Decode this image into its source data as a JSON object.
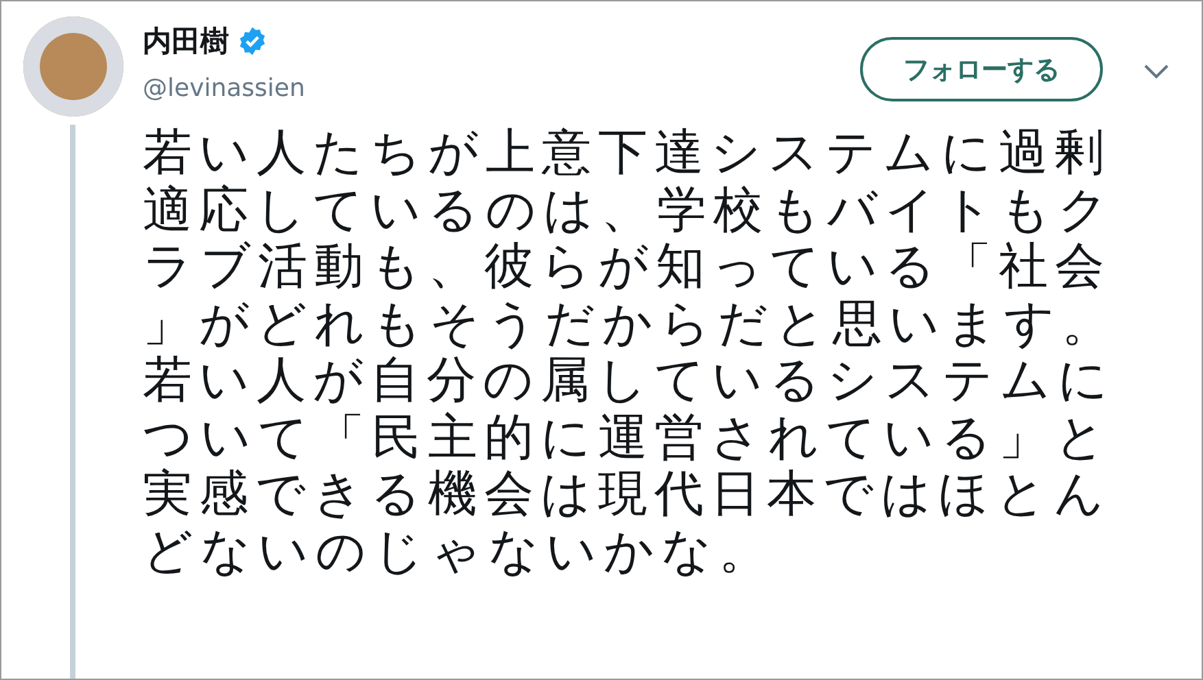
{
  "tweet": {
    "author": {
      "name": "内田樹",
      "verified": true,
      "handle": "@levinassien"
    },
    "follow_button": "フォローする",
    "text": "若い人たちが上意下達システムに過剰適応しているのは、学校もバイトもクラブ活動も、彼らが知っている「社会」がどれもそうだからだと思います。若い人が自分の属しているシステムについて「民主的に運営されている」と実感できる機会は現代日本ではほとんどないのじゃないかな。"
  }
}
